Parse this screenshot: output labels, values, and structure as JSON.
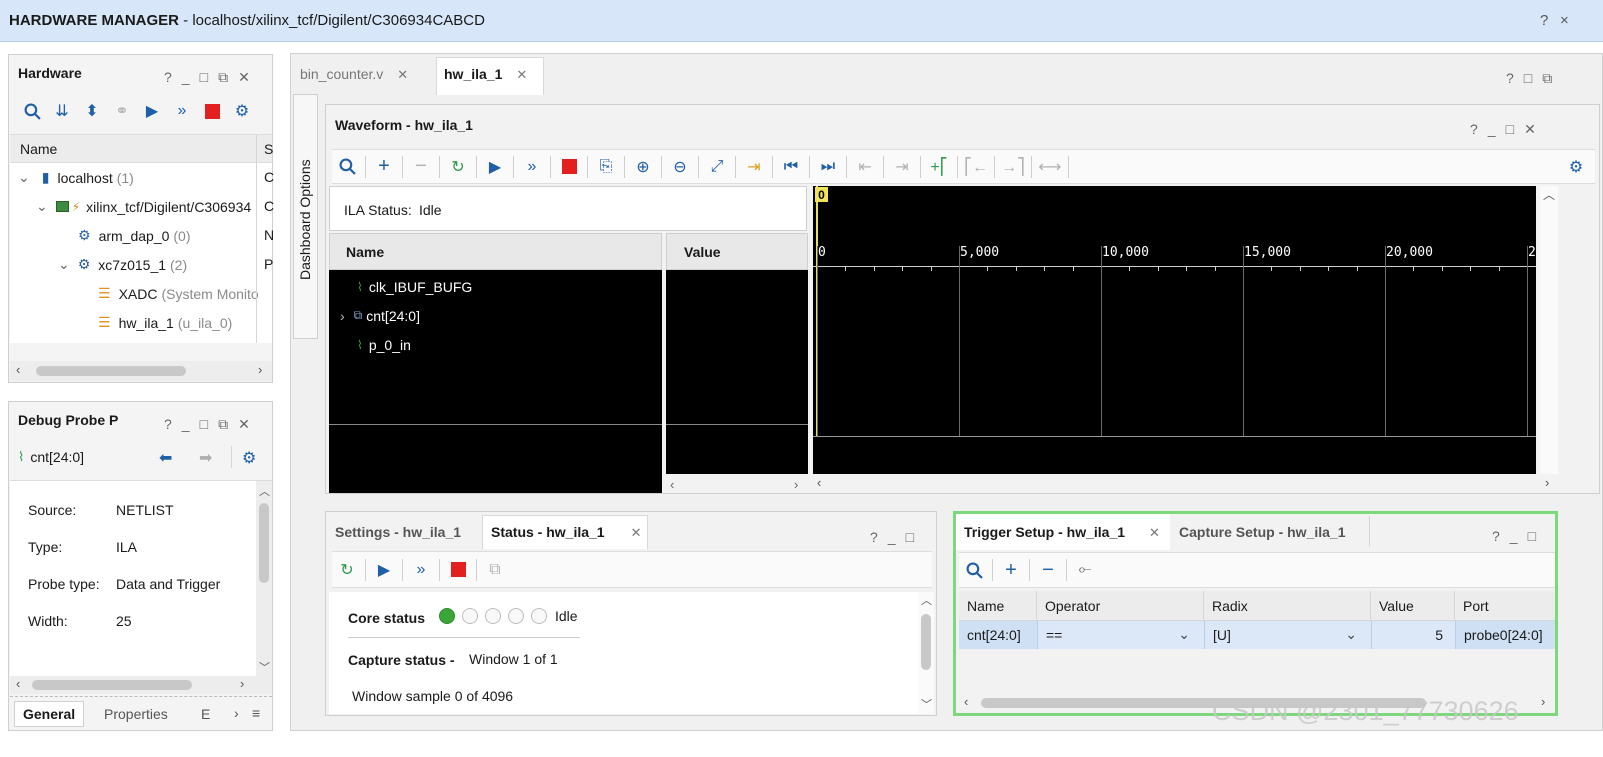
{
  "window": {
    "title_bold": "HARDWARE MANAGER",
    "title_path": " - localhost/xilinx_tcf/Digilent/C306934CABCD",
    "help": "?",
    "close": "×"
  },
  "hardware_panel": {
    "title": "Hardware",
    "col_name": "Name",
    "col_status": "S",
    "rows": [
      {
        "label": "localhost",
        "count": "(1)",
        "status": "C"
      },
      {
        "label": "xilinx_tcf/Digilent/C306934",
        "count": "",
        "status": "C"
      },
      {
        "label": "arm_dap_0",
        "count": "(0)",
        "status": "N"
      },
      {
        "label": "xc7z015_1",
        "count": "(2)",
        "status": "P"
      },
      {
        "label": "XADC",
        "count": "(System Monito",
        "status": ""
      },
      {
        "label": "hw_ila_1",
        "count": "(u_ila_0)",
        "status": ""
      }
    ]
  },
  "debug_probe_panel": {
    "title": "Debug Probe P",
    "probe": "cnt[24:0]",
    "props": [
      {
        "key": "Source:",
        "value": "NETLIST"
      },
      {
        "key": "Type:",
        "value": "ILA"
      },
      {
        "key": "Probe type:",
        "value": "Data and Trigger"
      },
      {
        "key": "Width:",
        "value": "25"
      }
    ],
    "tabs": [
      "General",
      "Properties",
      "E"
    ]
  },
  "editor_tabs": [
    {
      "label": "bin_counter.v",
      "active": false
    },
    {
      "label": "hw_ila_1",
      "active": true
    }
  ],
  "dashboard_options": "Dashboard Options",
  "waveform": {
    "title": "Waveform - hw_ila_1",
    "ila_status_label": "ILA Status:",
    "ila_status_value": "Idle",
    "col_name": "Name",
    "col_value": "Value",
    "signals": [
      "clk_IBUF_BUFG",
      "cnt[24:0]",
      "p_0_in"
    ],
    "marker": "0",
    "ticks": [
      "0",
      "5,000",
      "10,000",
      "15,000",
      "20,000",
      "2"
    ]
  },
  "status_panel": {
    "tabs": [
      "Settings - hw_ila_1",
      "Status - hw_ila_1"
    ],
    "core_status_label": "Core status",
    "core_status_value": "Idle",
    "capture_status_label": "Capture status -",
    "capture_status_value": "Window 1 of 1",
    "window_sample": "Window sample 0 of 4096"
  },
  "trigger_panel": {
    "tabs": [
      "Trigger Setup - hw_ila_1",
      "Capture Setup - hw_ila_1"
    ],
    "columns": [
      "Name",
      "Operator",
      "Radix",
      "Value",
      "Port"
    ],
    "row": {
      "name": "cnt[24:0]",
      "operator": "==",
      "radix": "[U]",
      "value": "5",
      "port": "probe0[24:0]"
    },
    "highlight_color": "#7dd87d"
  },
  "watermark": "CSDN @2301_77730626"
}
